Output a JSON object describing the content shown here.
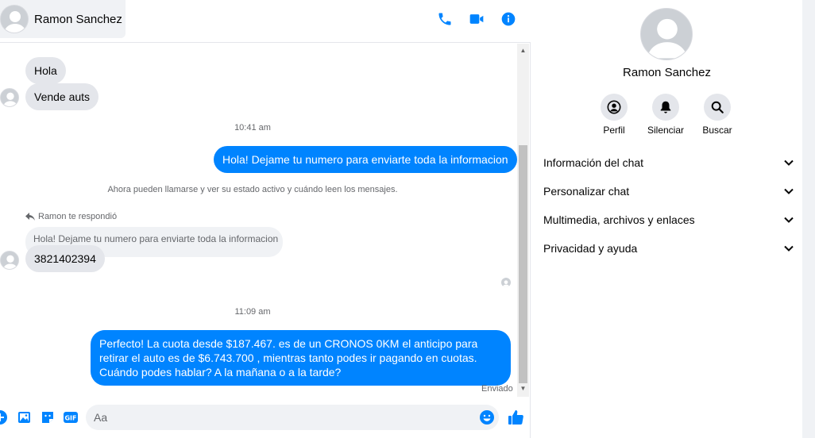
{
  "header": {
    "contact_name": "Ramon Sanchez"
  },
  "messages": {
    "in_1": "Hola",
    "in_2": "Vende auts",
    "ts_1": "10:41 am",
    "out_1": "Hola! Dejame tu numero  para enviarte toda la informacion",
    "system_1": "Ahora pueden llamarse y ver su estado activo y cuándo leen los mensajes.",
    "reply_label": "Ramon te respondió",
    "reply_quote": "Hola! Dejame tu numero  para enviarte toda la informacion",
    "in_3": "3821402394",
    "ts_2": "11:09 am",
    "out_2": "Perfecto! La cuota desde $187.467. es de un CRONOS 0KM el anticipo para retirar el auto es de $6.743.700 , mientras tanto podes ir pagando en cuotas. Cuándo podes hablar? A la mañana o a la tarde?",
    "status": "Enviado"
  },
  "composer": {
    "placeholder": "Aa"
  },
  "sidebar": {
    "name": "Ramon Sanchez",
    "actions": {
      "profile": "Perfil",
      "mute": "Silenciar",
      "search": "Buscar"
    },
    "sections": {
      "chat_info": "Información del chat",
      "customize": "Personalizar chat",
      "media": "Multimedia, archivos y enlaces",
      "privacy": "Privacidad y ayuda"
    }
  },
  "colors": {
    "accent": "#0084ff",
    "bubble_in": "#e4e6eb",
    "muted_text": "#65676b"
  }
}
